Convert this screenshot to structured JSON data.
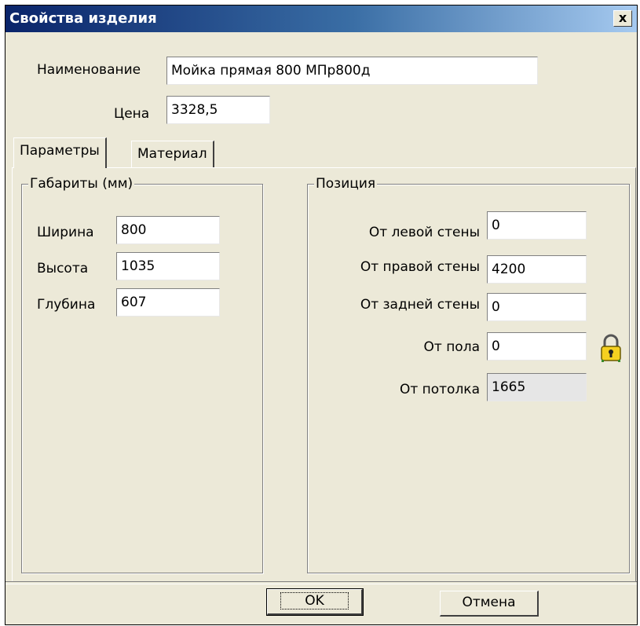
{
  "window": {
    "title": "Свойства изделия",
    "close_label": "x"
  },
  "header": {
    "name_label": "Наименование",
    "name_value": "Мойка прямая 800 МПр800д",
    "price_label": "Цена",
    "price_value": "3328,5"
  },
  "tabs": [
    {
      "label": "Параметры",
      "active": true
    },
    {
      "label": "Материал",
      "active": false
    }
  ],
  "dimensions": {
    "title": "Габариты (мм)",
    "width_label": "Ширина",
    "width_value": "800",
    "height_label": "Высота",
    "height_value": "1035",
    "depth_label": "Глубина",
    "depth_value": "607"
  },
  "position": {
    "title": "Позиция",
    "left_wall_label": "От левой стены",
    "left_wall_value": "0",
    "right_wall_label": "От правой стены",
    "right_wall_value": "4200",
    "back_wall_label": "От задней стены",
    "back_wall_value": "0",
    "floor_label": "От пола",
    "floor_value": "0",
    "ceiling_label": "От потолка",
    "ceiling_value": "1665",
    "lock_icon": "padlock-icon"
  },
  "buttons": {
    "ok_label": "OK",
    "cancel_label": "Отмена"
  }
}
